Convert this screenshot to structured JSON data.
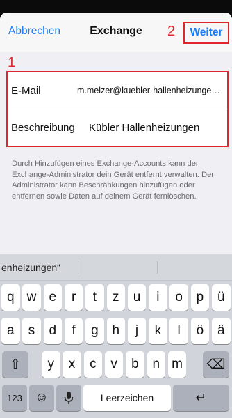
{
  "nav": {
    "cancel": "Abbrechen",
    "title": "Exchange",
    "next": "Weiter"
  },
  "annotations": {
    "one": "1",
    "two": "2"
  },
  "form": {
    "email_label": "E-Mail",
    "email_value": "m.melzer@kuebler-hallenheizungen.de",
    "description_label": "Beschreibung",
    "description_value": "Kübler Hallenheizungen"
  },
  "info_text": "Durch Hinzufügen eines Exchange-Accounts kann der Exchange-Administrator dein Gerät entfernt verwalten. Der Administrator kann Beschränkungen hinzufügen oder entfernen sowie Daten auf deinem Gerät fernlöschen.",
  "keyboard": {
    "prediction": "enheizungen“",
    "row1": [
      "q",
      "w",
      "e",
      "r",
      "t",
      "z",
      "u",
      "i",
      "o",
      "p",
      "ü"
    ],
    "row2": [
      "a",
      "s",
      "d",
      "f",
      "g",
      "h",
      "j",
      "k",
      "l",
      "ö",
      "ä"
    ],
    "row3": [
      "y",
      "x",
      "c",
      "v",
      "b",
      "n",
      "m"
    ],
    "shift": "⇧",
    "delete": "⌫",
    "numbers": "123",
    "emoji": "☺",
    "mic": "🎙",
    "space": "Leerzeichen",
    "return": "↵"
  },
  "colors": {
    "accent": "#1a7cf5",
    "annotation": "#e0262d"
  }
}
